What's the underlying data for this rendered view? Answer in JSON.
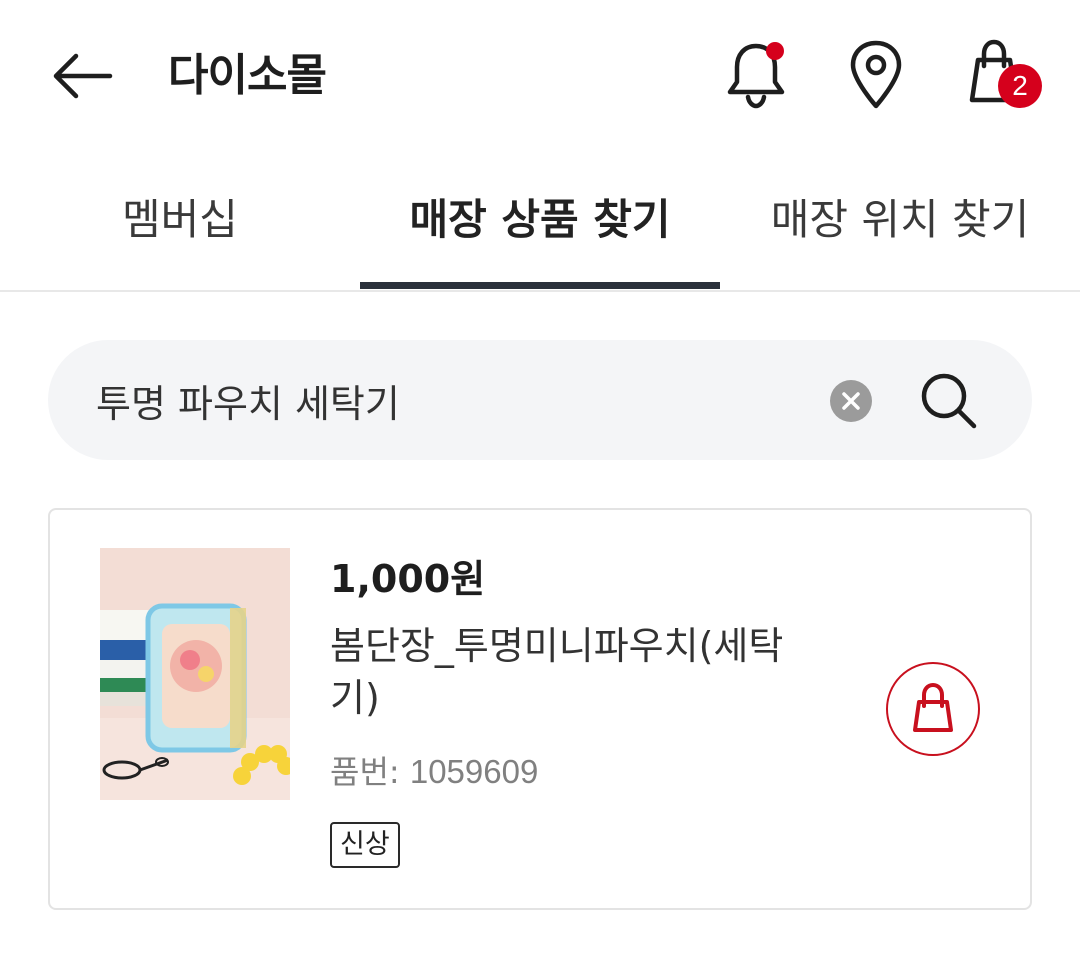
{
  "header": {
    "title": "다이소몰",
    "back_icon": "arrow-left-icon",
    "notification_icon": "bell-icon",
    "location_icon": "map-pin-icon",
    "cart_icon": "shopping-bag-icon",
    "cart_count": "2"
  },
  "tabs": [
    {
      "label": "멤버십",
      "active": false
    },
    {
      "label": "매장 상품 찾기",
      "active": true
    },
    {
      "label": "매장 위치 찾기",
      "active": false
    }
  ],
  "search": {
    "value": "투명 파우치 세탁기",
    "clear_icon": "clear-icon",
    "search_icon": "search-icon"
  },
  "products": [
    {
      "price": "1,000원",
      "name": "봄단장_투명미니파우치(세탁기)",
      "code_label": "품번:",
      "code": "1059609",
      "badge": "신상",
      "cart_icon": "shopping-bag-icon"
    }
  ],
  "colors": {
    "accent_red": "#d5001c",
    "tab_active": "#2a313b",
    "search_bg": "#f4f5f7"
  }
}
